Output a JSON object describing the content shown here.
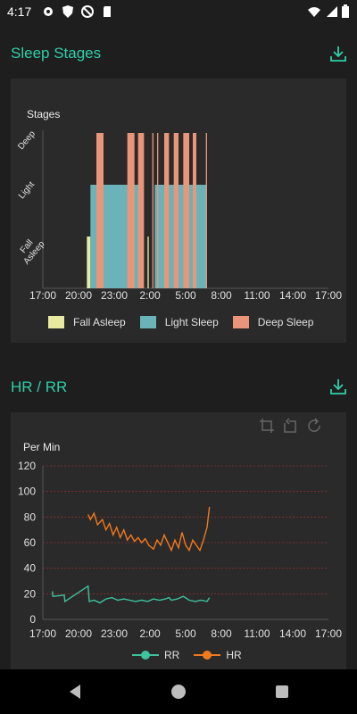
{
  "status_bar": {
    "time": "4:17"
  },
  "sleep_section": {
    "title": "Sleep Stages"
  },
  "hr_section": {
    "title": "HR / RR"
  },
  "colors": {
    "accent": "#2ecfa8",
    "fall_asleep": "#e8eaa0",
    "light_sleep": "#6ab3b8",
    "deep_sleep": "#e99579",
    "hr": "#f07a1e",
    "rr": "#3fc29e",
    "grid": "#8a2f2f"
  },
  "chart_data": [
    {
      "type": "bar",
      "title": "",
      "ylabel": "Stages",
      "y_categories": [
        "Fall Asleep",
        "Light",
        "Deep"
      ],
      "x_ticks": [
        "17:00",
        "20:00",
        "23:00",
        "2:00",
        "5:00",
        "8:00",
        "11:00",
        "14:00",
        "17:00"
      ],
      "x_range_hours": [
        0,
        24
      ],
      "legend_position": "bottom",
      "legend": [
        "Fall Asleep",
        "Light Sleep",
        "Deep Sleep"
      ],
      "series": [
        {
          "name": "Fall Asleep",
          "level": 1,
          "segments": [
            [
              3.7,
              4.0
            ],
            [
              4.1,
              4.2
            ],
            [
              8.8,
              8.9
            ]
          ]
        },
        {
          "name": "Light Sleep",
          "level": 2,
          "segments": [
            [
              4.0,
              8.4
            ],
            [
              9.4,
              13.8
            ]
          ]
        },
        {
          "name": "Deep Sleep",
          "level": 3,
          "segments": [
            [
              4.5,
              5.1
            ],
            [
              7.1,
              7.7
            ],
            [
              8.0,
              8.5
            ],
            [
              9.2,
              9.3
            ],
            [
              9.6,
              9.7
            ],
            [
              10.2,
              10.6
            ],
            [
              11.0,
              11.4
            ],
            [
              11.8,
              12.3
            ],
            [
              12.6,
              12.9
            ],
            [
              13.7,
              13.8
            ]
          ]
        }
      ]
    },
    {
      "type": "line",
      "title": "",
      "ylabel": "Per Min",
      "ylim": [
        0,
        120
      ],
      "y_ticks": [
        0,
        20,
        40,
        60,
        80,
        100,
        120
      ],
      "x_ticks": [
        "17:00",
        "20:00",
        "23:00",
        "2:00",
        "5:00",
        "8:00",
        "11:00",
        "14:00",
        "17:00"
      ],
      "x_range_hours": [
        0,
        24
      ],
      "grid": true,
      "legend_position": "bottom",
      "series": [
        {
          "name": "RR",
          "points": [
            [
              0.8,
              22
            ],
            [
              0.85,
              18
            ],
            [
              1.8,
              19
            ],
            [
              1.85,
              14
            ],
            [
              3.8,
              26
            ],
            [
              3.9,
              14
            ],
            [
              4.3,
              15
            ],
            [
              4.8,
              13
            ],
            [
              5.3,
              16
            ],
            [
              5.8,
              17
            ],
            [
              6.3,
              15
            ],
            [
              6.8,
              16
            ],
            [
              7.3,
              15
            ],
            [
              7.8,
              14
            ],
            [
              8.3,
              15
            ],
            [
              8.8,
              14
            ],
            [
              9.3,
              16
            ],
            [
              9.8,
              15
            ],
            [
              10.3,
              16
            ],
            [
              10.6,
              17
            ],
            [
              10.8,
              15
            ],
            [
              11.3,
              16
            ],
            [
              11.8,
              18
            ],
            [
              12.3,
              15
            ],
            [
              12.8,
              14
            ],
            [
              13.3,
              15
            ],
            [
              13.8,
              14
            ],
            [
              14.0,
              17
            ]
          ]
        },
        {
          "name": "HR",
          "points": [
            [
              3.8,
              82
            ],
            [
              4.0,
              78
            ],
            [
              4.3,
              83
            ],
            [
              4.6,
              74
            ],
            [
              5.0,
              78
            ],
            [
              5.3,
              70
            ],
            [
              5.6,
              75
            ],
            [
              5.9,
              66
            ],
            [
              6.2,
              72
            ],
            [
              6.5,
              64
            ],
            [
              6.8,
              70
            ],
            [
              7.1,
              62
            ],
            [
              7.4,
              66
            ],
            [
              7.7,
              61
            ],
            [
              8.0,
              64
            ],
            [
              8.3,
              60
            ],
            [
              8.6,
              63
            ],
            [
              8.9,
              58
            ],
            [
              9.3,
              55
            ],
            [
              9.6,
              62
            ],
            [
              9.9,
              58
            ],
            [
              10.2,
              66
            ],
            [
              10.5,
              60
            ],
            [
              10.8,
              54
            ],
            [
              11.1,
              62
            ],
            [
              11.4,
              56
            ],
            [
              11.7,
              68
            ],
            [
              12.0,
              58
            ],
            [
              12.3,
              54
            ],
            [
              12.6,
              62
            ],
            [
              12.9,
              58
            ],
            [
              13.2,
              54
            ],
            [
              13.5,
              62
            ],
            [
              13.8,
              72
            ],
            [
              14.0,
              88
            ]
          ]
        }
      ]
    }
  ]
}
